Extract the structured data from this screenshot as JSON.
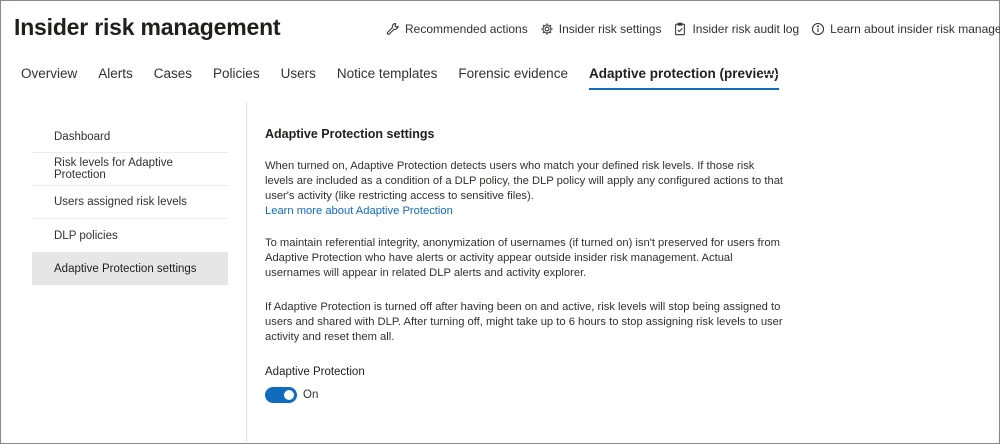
{
  "header": {
    "title": "Insider risk management",
    "actions": [
      {
        "icon": "wrench-icon",
        "label": "Recommended actions"
      },
      {
        "icon": "gear-icon",
        "label": "Insider risk settings"
      },
      {
        "icon": "audit-log-icon",
        "label": "Insider risk audit log"
      },
      {
        "icon": "info-icon",
        "label": "Learn about insider risk management"
      }
    ]
  },
  "tabs": [
    {
      "label": "Overview"
    },
    {
      "label": "Alerts"
    },
    {
      "label": "Cases"
    },
    {
      "label": "Policies"
    },
    {
      "label": "Users"
    },
    {
      "label": "Notice templates"
    },
    {
      "label": "Forensic evidence"
    },
    {
      "label": "Adaptive protection (preview)",
      "active": true
    }
  ],
  "sidebar": {
    "items": [
      {
        "label": "Dashboard"
      },
      {
        "label": "Risk levels for Adaptive Protection"
      },
      {
        "label": "Users assigned risk levels"
      },
      {
        "label": "DLP policies"
      },
      {
        "label": "Adaptive Protection settings",
        "selected": true
      }
    ]
  },
  "main": {
    "heading": "Adaptive Protection settings",
    "paragraph1": "When turned on, Adaptive Protection detects users who match your defined risk levels. If those risk levels are included as a condition of a DLP policy, the DLP policy will apply any configured actions to that user's activity (like restricting access to sensitive files).",
    "learn_more_link": "Learn more about Adaptive Protection",
    "paragraph2": "To maintain referential integrity, anonymization of usernames (if turned on) isn't preserved for users from Adaptive Protection who have alerts or activity appear outside insider risk management. Actual usernames will appear in related DLP alerts and activity explorer.",
    "paragraph3": "If Adaptive Protection is turned off after having been on and active, risk levels will stop being assigned to users and shared with DLP. After turning off, might take up to 6 hours to stop assigning risk levels to user activity and reset them all.",
    "toggle_label": "Adaptive Protection",
    "toggle_state": "On",
    "toggle_on": true
  },
  "colors": {
    "accent": "#0f6cbd",
    "selected_nav_bg": "#e6e6e6"
  }
}
